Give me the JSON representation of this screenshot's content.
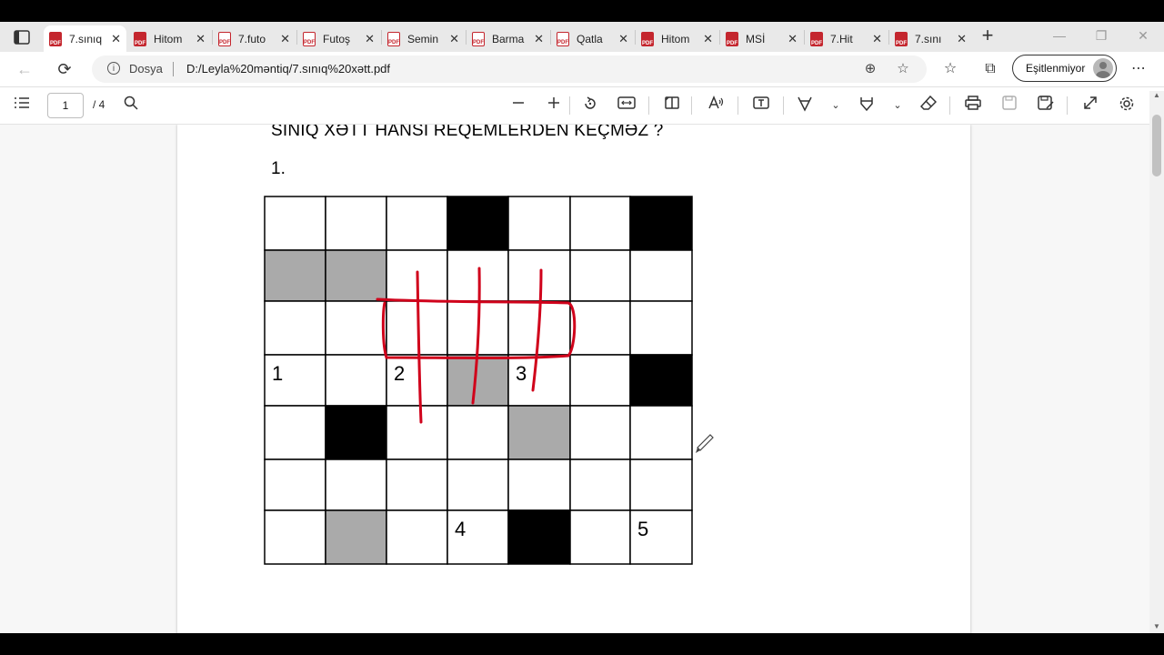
{
  "tabs": [
    {
      "label": "7.sınıq",
      "active": true
    },
    {
      "label": "Hitom",
      "active": false
    },
    {
      "label": "7.futo",
      "active": false
    },
    {
      "label": "Futoş",
      "active": false
    },
    {
      "label": "Semin",
      "active": false
    },
    {
      "label": "Barma",
      "active": false
    },
    {
      "label": "Qatla",
      "active": false
    },
    {
      "label": "Hitom",
      "active": false
    },
    {
      "label": "MSİ",
      "active": false
    },
    {
      "label": "7.Hit",
      "active": false
    },
    {
      "label": "7.sını",
      "active": false
    }
  ],
  "tab_icon_text": "PDF",
  "icons": {
    "tab_actions": "tab-actions-icon",
    "new_tab": "+",
    "minimize": "—",
    "restore": "❐",
    "close": "✕",
    "back": "←",
    "refresh": "⟳",
    "zoom": "⊕",
    "add_favorite": "☆",
    "favorites": "☆",
    "collections": "⧉",
    "more": "⋯"
  },
  "address_bar": {
    "site_label": "Dosya",
    "url": "D:/Leyla%20məntiq/7.sınıq%20xətt.pdf"
  },
  "sync_button": {
    "label": "Eşitlenmiyor"
  },
  "pdf_toolbar": {
    "page_current": "1",
    "page_total": "/ 4"
  },
  "document": {
    "title": "SINIQ XƏTT HANSI REQEMLERDEN KEÇMƏZ ?",
    "item_number": "1.",
    "grid": {
      "rows": 7,
      "cols": 7,
      "black_cells": [
        [
          0,
          3
        ],
        [
          0,
          6
        ],
        [
          3,
          6
        ],
        [
          4,
          1
        ],
        [
          6,
          4
        ]
      ],
      "gray_cells": [
        [
          1,
          0
        ],
        [
          1,
          1
        ],
        [
          3,
          3
        ],
        [
          4,
          4
        ],
        [
          6,
          1
        ]
      ],
      "labels": [
        {
          "text": "1",
          "row": 3,
          "col": 0
        },
        {
          "text": "2",
          "row": 3,
          "col": 2
        },
        {
          "text": "3",
          "row": 3,
          "col": 4
        },
        {
          "text": "4",
          "row": 6,
          "col": 3
        },
        {
          "text": "5",
          "row": 6,
          "col": 6
        }
      ]
    },
    "ink_color": "#d0021b"
  }
}
